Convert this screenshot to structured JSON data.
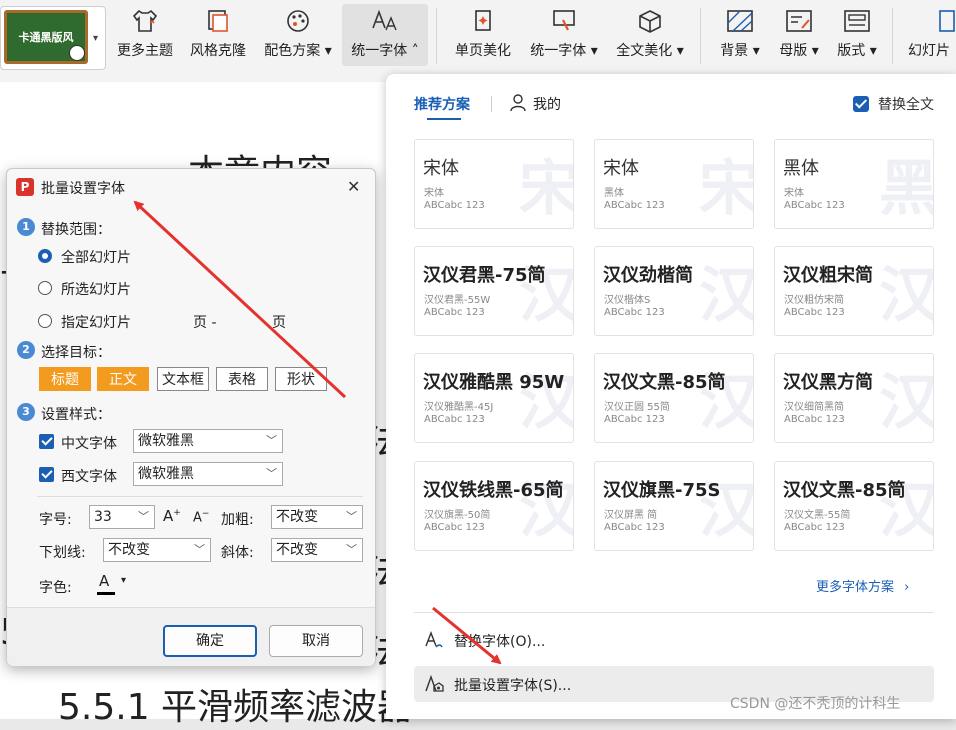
{
  "ribbon": {
    "theme_thumb_label": "卡通黑版风",
    "buttons": [
      "更多主题",
      "风格克隆",
      "配色方案",
      "统一字体",
      "单页美化",
      "统一字体",
      "全文美化",
      "背景",
      "母版",
      "版式",
      "幻灯片"
    ],
    "accent": "#1a5fb4"
  },
  "slide": {
    "top_text": "本章内容",
    "bottom_text": "5.5.1 平滑频率滤波器",
    "side_chars": [
      "卡",
      "5",
      "法",
      "法",
      "法"
    ]
  },
  "font_panel": {
    "tabs": {
      "recommend": "推荐方案",
      "mine": "我的"
    },
    "replace_all_label": "替换全文",
    "replace_all_checked": true,
    "cards": [
      {
        "name": "宋体",
        "sub": "宋体",
        "abc": "ABCabc 123",
        "wm": "宋"
      },
      {
        "name": "宋体",
        "sub": "黑体",
        "abc": "ABCabc 123",
        "wm": "宋"
      },
      {
        "name": "黑体",
        "sub": "宋体",
        "abc": "ABCabc 123",
        "wm": "黑"
      },
      {
        "name": "汉仪君黑-75简",
        "sub": "汉仪君黑-55W",
        "abc": "ABCabc 123",
        "wm": "汉"
      },
      {
        "name": "汉仪劲楷简",
        "sub": "汉仪楷体S",
        "abc": "ABCabc 123",
        "wm": "汉"
      },
      {
        "name": "汉仪粗宋简",
        "sub": "汉仪粗仿宋简",
        "abc": "ABCabc 123",
        "wm": "汉"
      },
      {
        "name": "汉仪雅酷黑 95W",
        "sub": "汉仪雅酷黑-45J",
        "abc": "ABCabc 123",
        "wm": "汉"
      },
      {
        "name": "汉仪文黑-85简",
        "sub": "汉仪正圆 55简",
        "abc": "ABCabc 123",
        "wm": "汉"
      },
      {
        "name": "汉仪黑方简",
        "sub": "汉仪细简黑简",
        "abc": "ABCabc 123",
        "wm": "汉"
      },
      {
        "name": "汉仪铁线黑-65简",
        "sub": "汉仪旗黑-50简",
        "abc": "ABCabc 123",
        "wm": "汉"
      },
      {
        "name": "汉仪旗黑-75S",
        "sub": "汉仪屏黑 简",
        "abc": "ABCabc 123",
        "wm": "汉"
      },
      {
        "name": "汉仪文黑-85简",
        "sub": "汉仪文黑-55简",
        "abc": "ABCabc 123",
        "wm": "汉"
      }
    ],
    "more_label": "更多字体方案",
    "replace_font_label": "替换字体(O)...",
    "batch_label": "批量设置字体(S)..."
  },
  "dialog": {
    "title": "批量设置字体",
    "section1": "替换范围：",
    "range_all": "全部幻灯片",
    "range_selected": "所选幻灯片",
    "range_specific": "指定幻灯片",
    "page_label1": "页 -",
    "page_label2": "页",
    "section2": "选择目标：",
    "targets": [
      "标题",
      "正文",
      "文本框",
      "表格",
      "形状"
    ],
    "section3": "设置样式：",
    "cn_font_label": "中文字体",
    "cn_font_value": "微软雅黑",
    "west_font_label": "西文字体",
    "west_font_value": "微软雅黑",
    "size_label": "字号:",
    "size_value": "33",
    "bold_label": "加粗:",
    "bold_value": "不改变",
    "underline_label": "下划线:",
    "underline_value": "不改变",
    "italic_label": "斜体:",
    "italic_value": "不改变",
    "color_label": "字色:",
    "ok_label": "确定",
    "cancel_label": "取消"
  },
  "watermark": "CSDN @还不秃顶的计科生"
}
